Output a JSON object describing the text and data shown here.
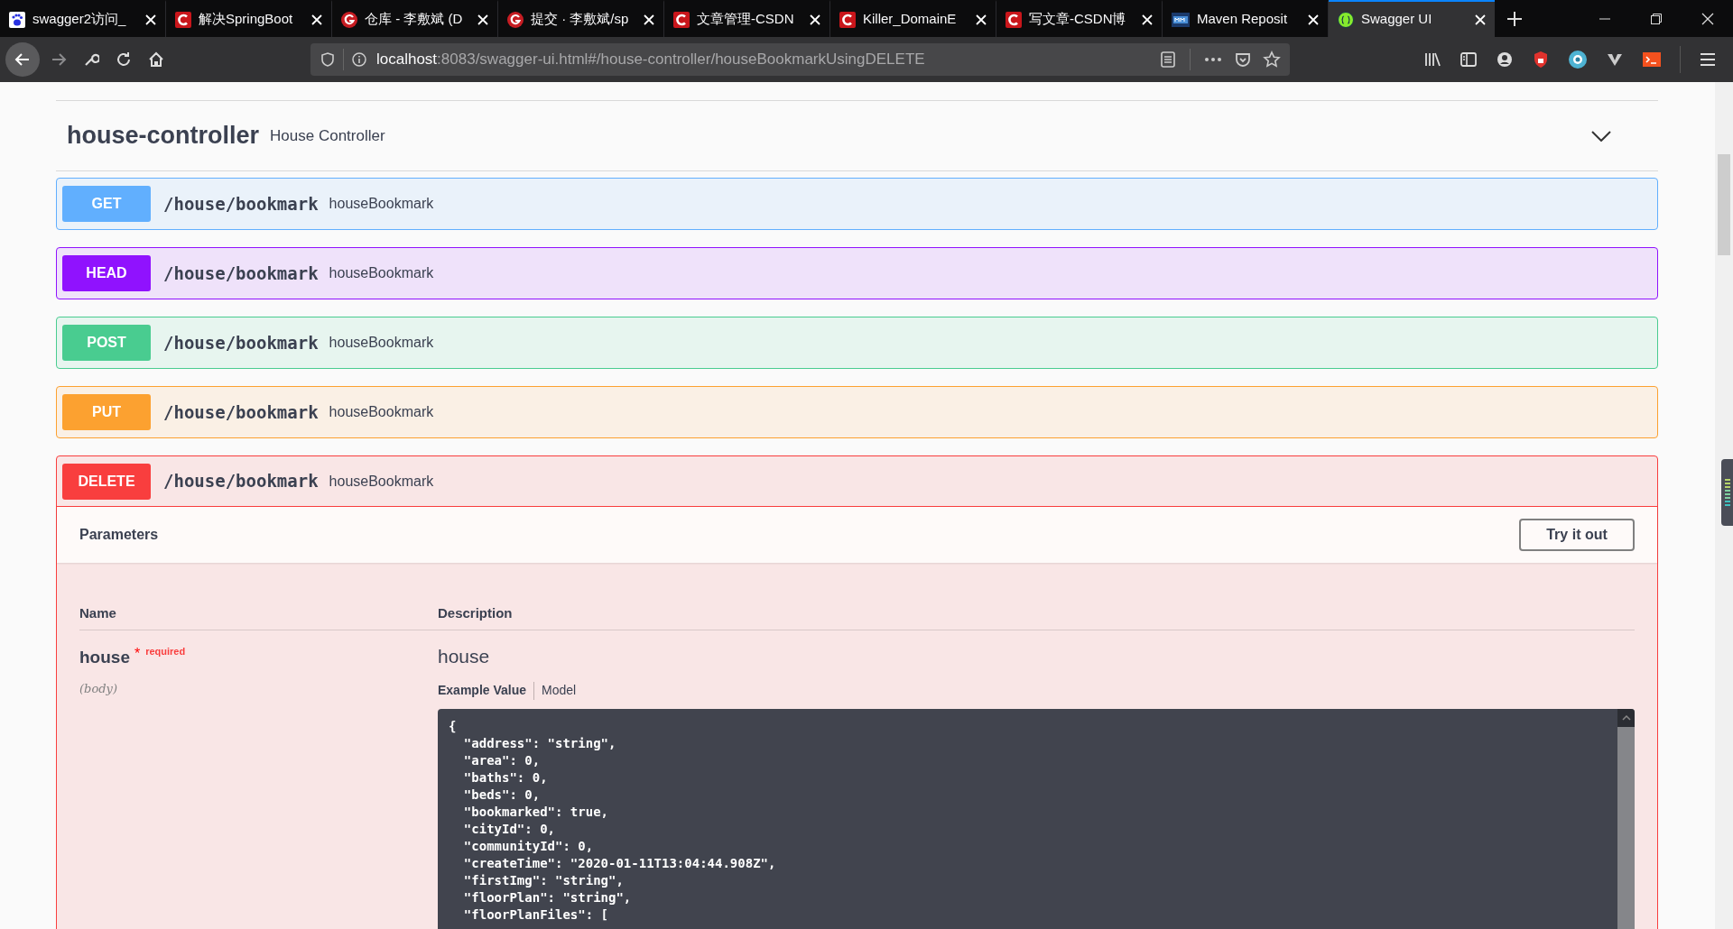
{
  "browser": {
    "tabs": [
      {
        "title": "swagger2访问_",
        "kind": "paw",
        "selected": false
      },
      {
        "title": "解决SpringBoot",
        "kind": "c",
        "selected": false
      },
      {
        "title": "仓库 - 李敷斌 (D",
        "kind": "g",
        "selected": false
      },
      {
        "title": "提交 · 李敷斌/sp",
        "kind": "g",
        "selected": false
      },
      {
        "title": "文章管理-CSDN",
        "kind": "c",
        "selected": false
      },
      {
        "title": "Killer_DomainE",
        "kind": "c",
        "selected": false
      },
      {
        "title": "写文章-CSDN博",
        "kind": "c",
        "selected": false
      },
      {
        "title": "Maven Reposit",
        "kind": "m",
        "selected": false
      },
      {
        "title": "Swagger UI",
        "kind": "braces",
        "selected": true
      }
    ],
    "url": {
      "host": "localhost",
      "rest": ":8083/swagger-ui.html#/house-controller/houseBookmarkUsingDELETE"
    }
  },
  "section": {
    "title": "house-controller",
    "description": "House Controller",
    "expanded": true
  },
  "operations": [
    {
      "method": "GET",
      "path": "/house/bookmark",
      "summary": "houseBookmark",
      "color": "#61affe",
      "expanded": false
    },
    {
      "method": "HEAD",
      "path": "/house/bookmark",
      "summary": "houseBookmark",
      "color": "#9012fe",
      "expanded": false
    },
    {
      "method": "POST",
      "path": "/house/bookmark",
      "summary": "houseBookmark",
      "color": "#49cc90",
      "expanded": false
    },
    {
      "method": "PUT",
      "path": "/house/bookmark",
      "summary": "houseBookmark",
      "color": "#fca130",
      "expanded": false
    },
    {
      "method": "DELETE",
      "path": "/house/bookmark",
      "summary": "houseBookmark",
      "color": "#f93e3e",
      "expanded": true,
      "parameters_title": "Parameters",
      "try_button": "Try it out",
      "columns": [
        "Name",
        "Description"
      ],
      "parameter": {
        "name": "house",
        "required_mark": "*",
        "required_label": "required",
        "in": "(body)",
        "description": "house",
        "tabs": [
          {
            "label": "Example Value",
            "selected": true
          },
          {
            "label": "Model",
            "selected": false
          }
        ],
        "example_lines": [
          "{",
          "  \"address\": \"string\",",
          "  \"area\": 0,",
          "  \"baths\": 0,",
          "  \"beds\": 0,",
          "  \"bookmarked\": true,",
          "  \"cityId\": 0,",
          "  \"communityId\": 0,",
          "  \"createTime\": \"2020-01-11T13:04:44.908Z\",",
          "  \"firstImg\": \"string\",",
          "  \"floorPlan\": \"string\",",
          "  \"floorPlanFiles\": ["
        ]
      }
    }
  ]
}
